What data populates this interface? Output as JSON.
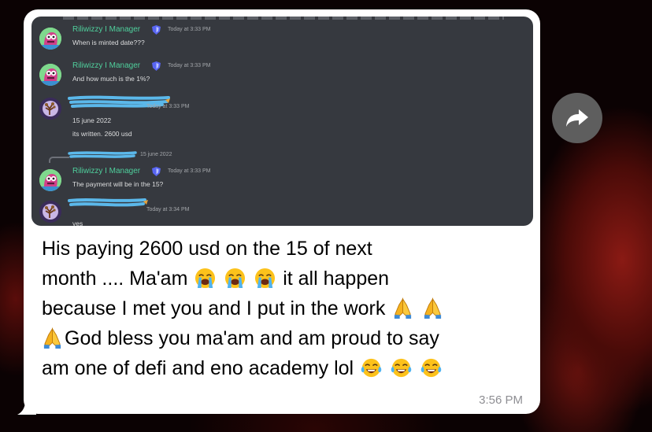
{
  "discord": {
    "messages": [
      {
        "username": "Riliwizzy I Manager",
        "time": "Today at 3:33 PM",
        "text": "When is minted date???"
      },
      {
        "username": "Riliwizzy I Manager",
        "time": "Today at 3:33 PM",
        "text": "And how much is the 1%?"
      },
      {
        "username": "",
        "time": "Today at 3:33 PM",
        "text": "15 june 2022",
        "text2": "its written. 2600 usd"
      },
      {
        "reply_time": "15 june 2022"
      },
      {
        "username": "Riliwizzy I Manager",
        "time": "Today at 3:33 PM",
        "text": "The payment will be in the 15?"
      },
      {
        "username": "",
        "time": "Today at 3:34 PM",
        "text": "yes"
      }
    ]
  },
  "message": {
    "line1": "His paying 2600 usd on the 15 of next",
    "line2a": "month .... Ma'am",
    "line2b": "it all happen",
    "line3": "because I met you and I put in the work",
    "line4": "God bless you ma'am and am proud to say",
    "line5": "am one of defi and eno academy lol",
    "time": "3:56 PM"
  },
  "icons": {
    "forward": "forward-arrow-icon",
    "crying": "loudly-crying-face-emoji",
    "praying": "folded-hands-emoji",
    "laughing": "tears-of-joy-emoji"
  },
  "colors": {
    "discord_bg": "#36393f",
    "username": "#4fcf9c",
    "redaction": "#5bb8ea",
    "bubble": "#ffffff",
    "forward_button": "#5e5e5e"
  }
}
